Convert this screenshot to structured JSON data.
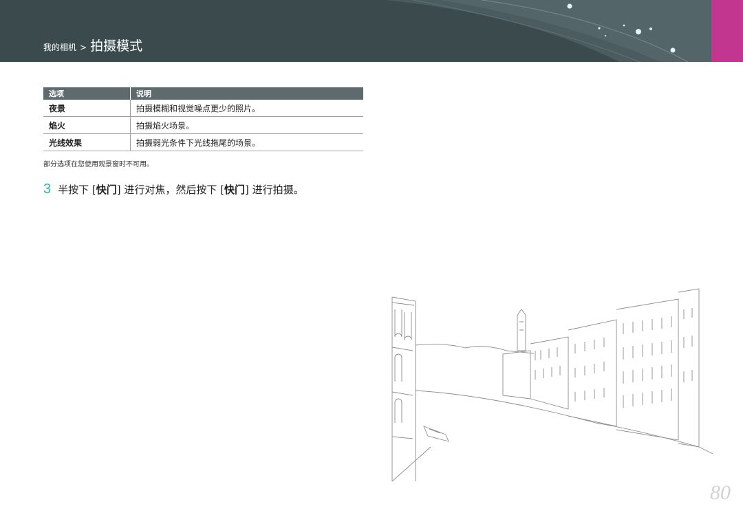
{
  "header": {
    "breadcrumb_parent": "我的相机",
    "breadcrumb_sep": ">",
    "breadcrumb_current": "拍摄模式",
    "accent_color": "#c2368f",
    "background_color": "#3a4a4d"
  },
  "table": {
    "col_option": "选项",
    "col_desc": "说明",
    "rows": [
      {
        "option": "夜景",
        "desc": "拍摄模糊和视觉噪点更少的照片。"
      },
      {
        "option": "焰火",
        "desc": "拍摄焰火场景。"
      },
      {
        "option": "光线效果",
        "desc": "拍摄弱光条件下光线拖尾的场景。"
      }
    ]
  },
  "note": "部分选项在您使用观景窗时不可用。",
  "step": {
    "number": "3",
    "text_1": "半按下 [",
    "key_1": "快门",
    "text_2": "] 进行对焦，然后按下 [",
    "key_2": "快门",
    "text_3": "] 进行拍摄。",
    "number_color": "#2fb8a2"
  },
  "page_number": "80"
}
